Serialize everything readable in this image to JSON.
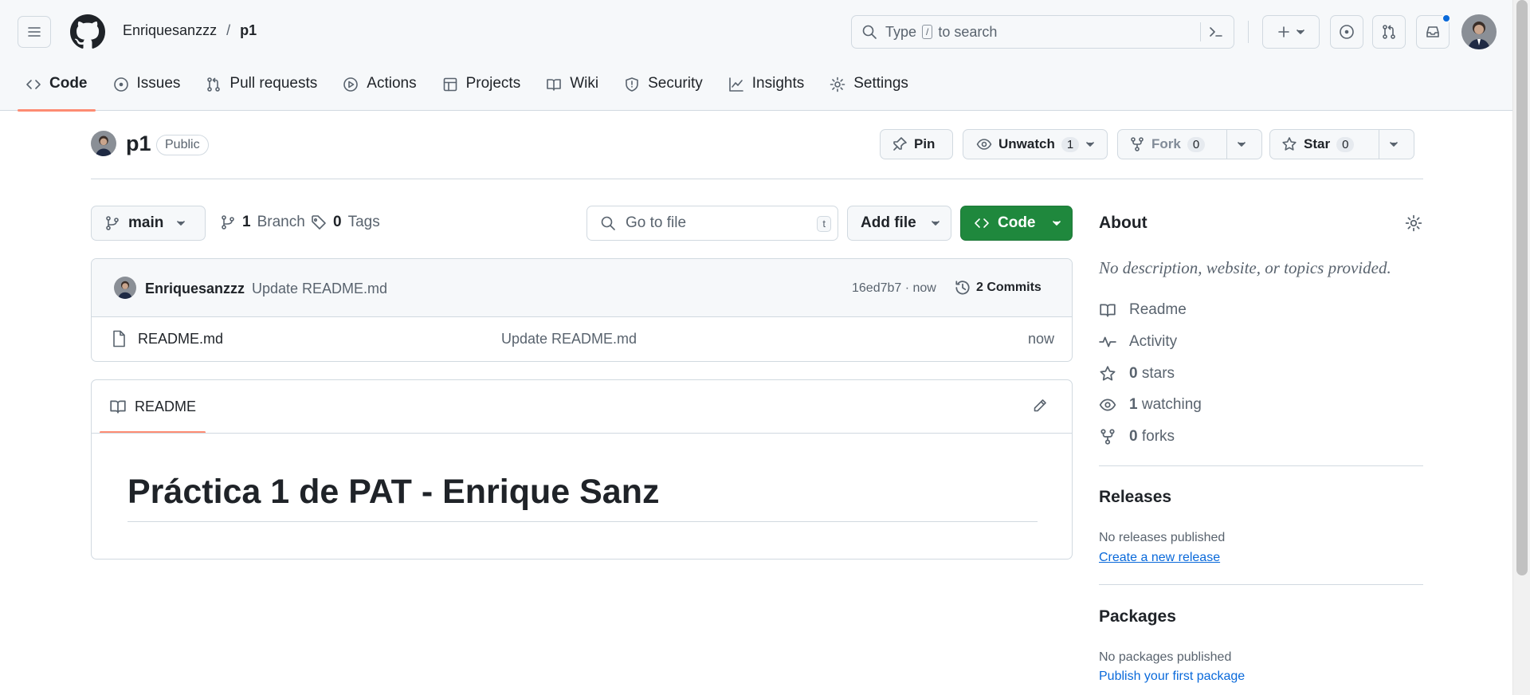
{
  "header": {
    "owner": "Enriquesanzzz",
    "separator": "/",
    "repo": "p1",
    "search_prefix": "Type",
    "search_key": "/",
    "search_suffix": "to search"
  },
  "tabs": [
    {
      "label": "Code",
      "icon": "code-icon",
      "active": true
    },
    {
      "label": "Issues",
      "icon": "issue-icon"
    },
    {
      "label": "Pull requests",
      "icon": "pull-request-icon"
    },
    {
      "label": "Actions",
      "icon": "play-icon"
    },
    {
      "label": "Projects",
      "icon": "table-icon"
    },
    {
      "label": "Wiki",
      "icon": "book-icon"
    },
    {
      "label": "Security",
      "icon": "shield-icon"
    },
    {
      "label": "Insights",
      "icon": "graph-icon"
    },
    {
      "label": "Settings",
      "icon": "gear-icon"
    }
  ],
  "repo_header": {
    "name": "p1",
    "visibility": "Public",
    "pin_label": "Pin",
    "watch_label": "Unwatch",
    "watch_count": "1",
    "fork_label": "Fork",
    "fork_count": "0",
    "star_label": "Star",
    "star_count": "0"
  },
  "toolbar": {
    "branch": "main",
    "branches_count": "1",
    "branches_label": "Branch",
    "tags_count": "0",
    "tags_label": "Tags",
    "goto_placeholder": "Go to file",
    "goto_key": "t",
    "add_file_label": "Add file",
    "code_label": "Code"
  },
  "latest_commit": {
    "author": "Enriquesanzzz",
    "message": "Update README.md",
    "hash_time": "16ed7b7 · now",
    "commits_label": "2 Commits"
  },
  "files": [
    {
      "name": "README.md",
      "message": "Update README.md",
      "time": "now"
    }
  ],
  "readme": {
    "tab_label": "README",
    "heading": "Práctica 1 de PAT - Enrique Sanz"
  },
  "about": {
    "title": "About",
    "description": "No description, website, or topics provided.",
    "readme_label": "Readme",
    "activity_label": "Activity",
    "stars_count": "0",
    "stars_label": "stars",
    "watching_count": "1",
    "watching_label": "watching",
    "forks_count": "0",
    "forks_label": "forks"
  },
  "releases": {
    "title": "Releases",
    "empty_text": "No releases published",
    "create_link": "Create a new release"
  },
  "packages": {
    "title": "Packages",
    "empty_text": "No packages published",
    "publish_link": "Publish your first package"
  },
  "colors": {
    "accent_green": "#1f883d",
    "active_tab_underline": "#fd8c73",
    "link_blue": "#0969da",
    "notification_dot": "#0969da"
  }
}
